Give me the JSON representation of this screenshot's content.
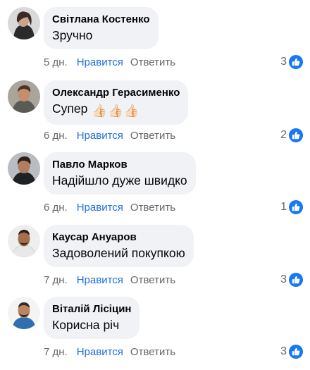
{
  "colors": {
    "bubble": "#f0f2f5",
    "like_link": "#216fdb",
    "muted": "#65676b",
    "reaction_badge": "#1877f2"
  },
  "comments": [
    {
      "author": "Світлана Костенко",
      "text": "Зручно",
      "emoji": [],
      "age": "5 дн.",
      "like_label": "Нравится",
      "reply_label": "Ответить",
      "reaction_count": "3",
      "reaction_icon": "thumbs-up-icon"
    },
    {
      "author": "Олександр Герасименко",
      "text": "Супер",
      "emoji": [
        "👍🏻",
        "👍🏻",
        "👍🏻"
      ],
      "age": "6 дн.",
      "like_label": "Нравится",
      "reply_label": "Ответить",
      "reaction_count": "2",
      "reaction_icon": "thumbs-up-icon"
    },
    {
      "author": "Павло Марков",
      "text": "Надійшло дуже швидко",
      "emoji": [],
      "age": "6 дн.",
      "like_label": "Нравится",
      "reply_label": "Ответить",
      "reaction_count": "1",
      "reaction_icon": "thumbs-up-icon"
    },
    {
      "author": "Каусар Ануаров",
      "text": "Задоволений покупкою",
      "emoji": [],
      "age": "7 дн.",
      "like_label": "Нравится",
      "reply_label": "Ответить",
      "reaction_count": "3",
      "reaction_icon": "thumbs-up-icon"
    },
    {
      "author": "Віталій Лісіцин",
      "text": "Корисна річ",
      "emoji": [],
      "age": "7 дн.",
      "like_label": "Нравится",
      "reply_label": "Ответить",
      "reaction_count": "3",
      "reaction_icon": "thumbs-up-icon"
    }
  ]
}
